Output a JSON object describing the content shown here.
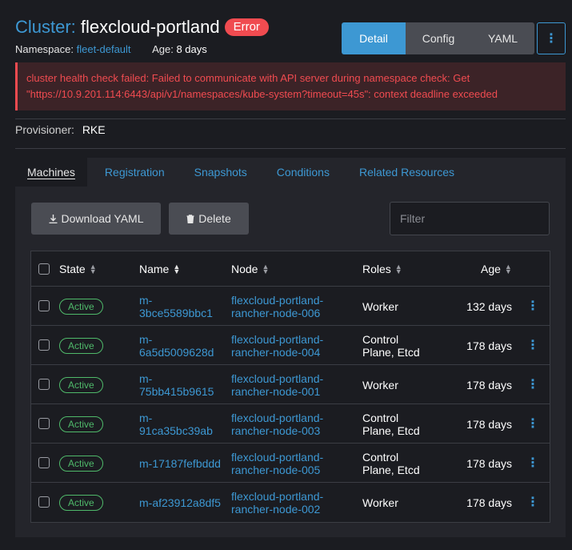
{
  "header": {
    "kind": "Cluster:",
    "name": "flexcloud-portland",
    "status": "Error",
    "namespace_label": "Namespace:",
    "namespace_value": "fleet-default",
    "age_label": "Age:",
    "age_value": "8 days"
  },
  "view_toggle": [
    "Detail",
    "Config",
    "YAML"
  ],
  "error_message_line1": "cluster health check failed: Failed to communicate with API server during namespace check: Get",
  "error_message_line2": "\"https://10.9.201.114:6443/api/v1/namespaces/kube-system?timeout=45s\": context deadline exceeded",
  "provisioner": {
    "label": "Provisioner:",
    "value": "RKE"
  },
  "tabs": [
    "Machines",
    "Registration",
    "Snapshots",
    "Conditions",
    "Related Resources"
  ],
  "toolbar": {
    "download_label": "Download YAML",
    "delete_label": "Delete",
    "filter_placeholder": "Filter"
  },
  "columns": [
    "State",
    "Name",
    "Node",
    "Roles",
    "Age"
  ],
  "rows": [
    {
      "state": "Active",
      "name_1": "m-",
      "name_2": "3bce5589bbc1",
      "node_1": "flexcloud-portland-",
      "node_2": "rancher-node-006",
      "roles_1": "Worker",
      "roles_2": "",
      "age": "132 days"
    },
    {
      "state": "Active",
      "name_1": "m-",
      "name_2": "6a5d5009628d",
      "node_1": "flexcloud-portland-",
      "node_2": "rancher-node-004",
      "roles_1": "Control",
      "roles_2": "Plane, Etcd",
      "age": "178 days"
    },
    {
      "state": "Active",
      "name_1": "m-",
      "name_2": "75bb415b9615",
      "node_1": "flexcloud-portland-",
      "node_2": "rancher-node-001",
      "roles_1": "Worker",
      "roles_2": "",
      "age": "178 days"
    },
    {
      "state": "Active",
      "name_1": "m-",
      "name_2": "91ca35bc39ab",
      "node_1": "flexcloud-portland-",
      "node_2": "rancher-node-003",
      "roles_1": "Control",
      "roles_2": "Plane, Etcd",
      "age": "178 days"
    },
    {
      "state": "Active",
      "name_1": "m-17187fefbddd",
      "name_2": "",
      "node_1": "flexcloud-portland-",
      "node_2": "rancher-node-005",
      "roles_1": "Control",
      "roles_2": "Plane, Etcd",
      "age": "178 days"
    },
    {
      "state": "Active",
      "name_1": "m-af23912a8df5",
      "name_2": "",
      "node_1": "flexcloud-portland-",
      "node_2": "rancher-node-002",
      "roles_1": "Worker",
      "roles_2": "",
      "age": "178 days"
    }
  ],
  "colors": {
    "accent": "#3d98d3",
    "error": "#f04b50",
    "active": "#4fb96a"
  }
}
